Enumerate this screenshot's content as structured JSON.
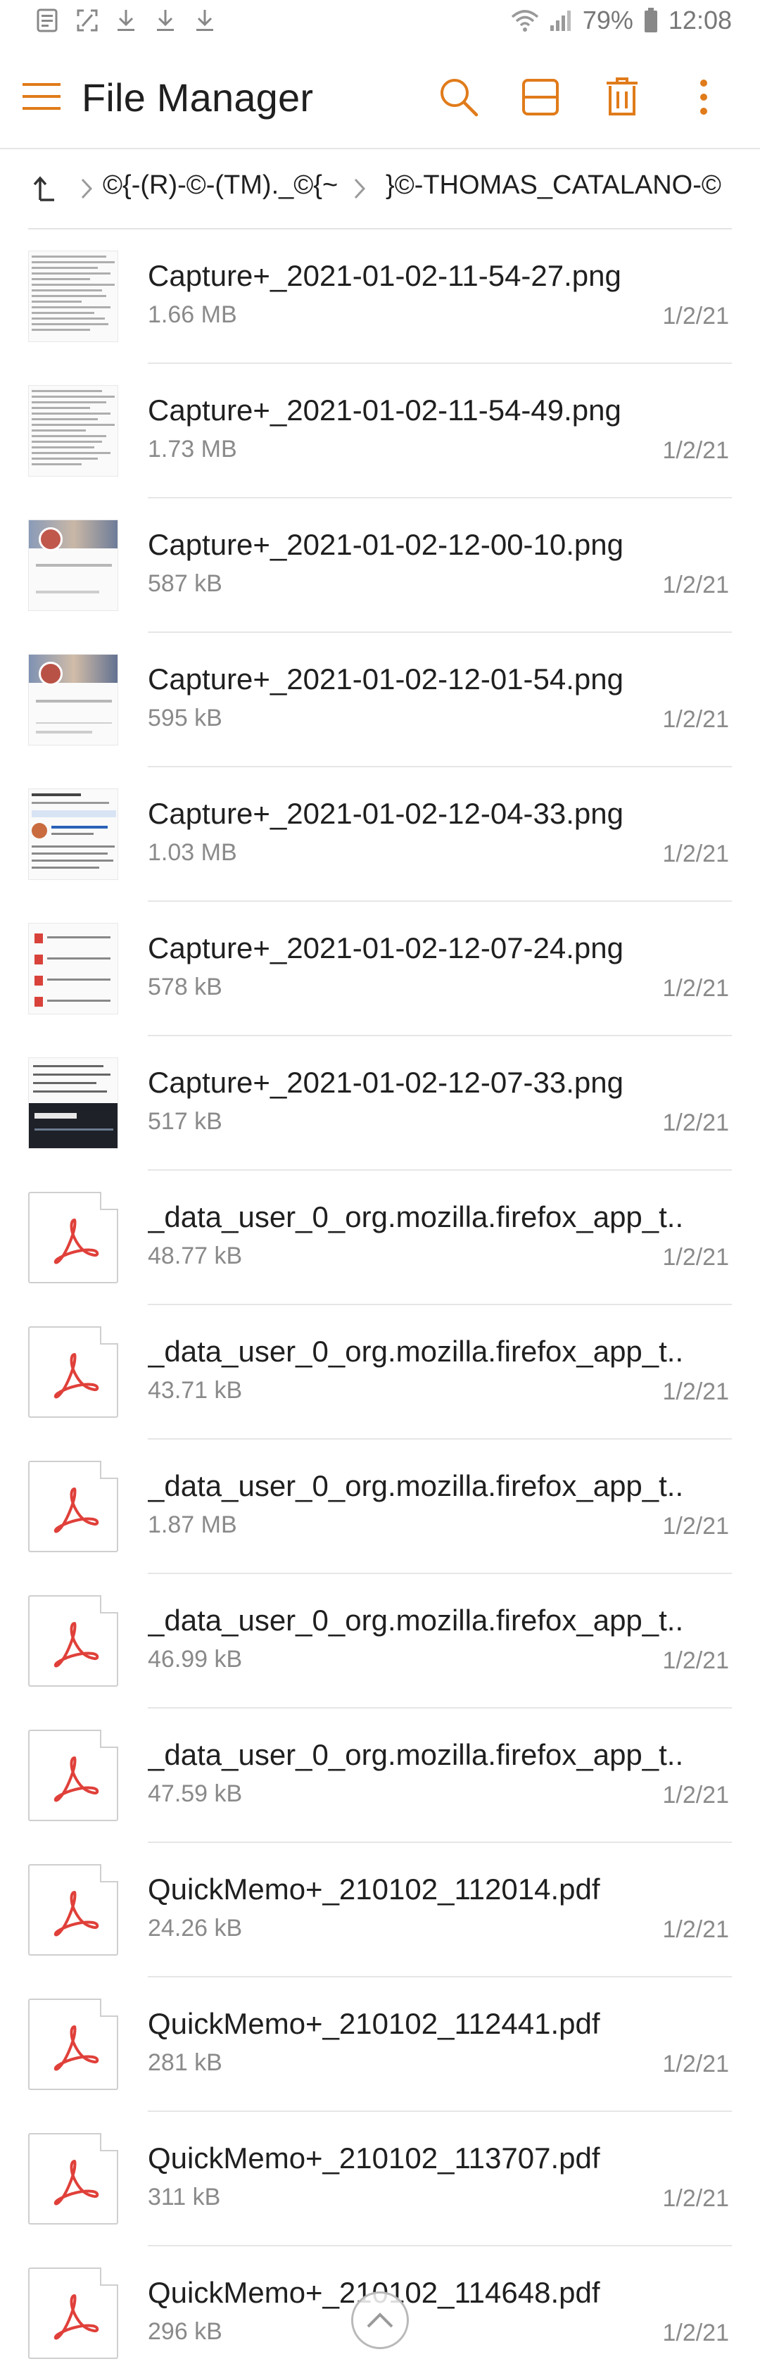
{
  "status_bar": {
    "battery_percent": "79%",
    "time": "12:08",
    "left_icons": [
      "notification-icon",
      "screenshot-icon",
      "download-icon",
      "download-icon",
      "download-icon"
    ],
    "right_icons": [
      "wifi-icon",
      "signal-icon",
      "battery-icon"
    ]
  },
  "app_bar": {
    "title": "File Manager",
    "actions": [
      "search-icon",
      "view-toggle-icon",
      "delete-icon",
      "more-vert-icon"
    ]
  },
  "breadcrumb": {
    "segments": [
      "©{-(R)-©-(TM)._©{~",
      "}©-THOMAS_CATALANO-©"
    ]
  },
  "colors": {
    "accent": "#e07b1a",
    "pdf_red": "#e0403a",
    "secondary_text": "#8a8a8a",
    "divider": "#e6e6e6"
  },
  "files": [
    {
      "name": "Capture+_2021-01-02-11-54-27.png",
      "size": "1.66 MB",
      "date": "1/2/21",
      "type": "image-text"
    },
    {
      "name": "Capture+_2021-01-02-11-54-49.png",
      "size": "1.73 MB",
      "date": "1/2/21",
      "type": "image-text"
    },
    {
      "name": "Capture+_2021-01-02-12-00-10.png",
      "size": "587 kB",
      "date": "1/2/21",
      "type": "image-photo"
    },
    {
      "name": "Capture+_2021-01-02-12-01-54.png",
      "size": "595 kB",
      "date": "1/2/21",
      "type": "image-photo"
    },
    {
      "name": "Capture+_2021-01-02-12-04-33.png",
      "size": "1.03 MB",
      "date": "1/2/21",
      "type": "image-web"
    },
    {
      "name": "Capture+_2021-01-02-12-07-24.png",
      "size": "578 kB",
      "date": "1/2/21",
      "type": "image-list"
    },
    {
      "name": "Capture+_2021-01-02-12-07-33.png",
      "size": "517 kB",
      "date": "1/2/21",
      "type": "image-dark"
    },
    {
      "name": "_data_user_0_org.mozilla.firefox_app_t..",
      "size": "48.77 kB",
      "date": "1/2/21",
      "type": "pdf"
    },
    {
      "name": "_data_user_0_org.mozilla.firefox_app_t..",
      "size": "43.71 kB",
      "date": "1/2/21",
      "type": "pdf"
    },
    {
      "name": "_data_user_0_org.mozilla.firefox_app_t..",
      "size": "1.87 MB",
      "date": "1/2/21",
      "type": "pdf"
    },
    {
      "name": "_data_user_0_org.mozilla.firefox_app_t..",
      "size": "46.99 kB",
      "date": "1/2/21",
      "type": "pdf"
    },
    {
      "name": "_data_user_0_org.mozilla.firefox_app_t..",
      "size": "47.59 kB",
      "date": "1/2/21",
      "type": "pdf"
    },
    {
      "name": "QuickMemo+_210102_112014.pdf",
      "size": "24.26 kB",
      "date": "1/2/21",
      "type": "pdf"
    },
    {
      "name": "QuickMemo+_210102_112441.pdf",
      "size": "281 kB",
      "date": "1/2/21",
      "type": "pdf"
    },
    {
      "name": "QuickMemo+_210102_113707.pdf",
      "size": "311 kB",
      "date": "1/2/21",
      "type": "pdf"
    },
    {
      "name": "QuickMemo+_210102_114648.pdf",
      "size": "296 kB",
      "date": "1/2/21",
      "type": "pdf"
    }
  ],
  "scroll_top": {
    "icon": "chevron-up-icon"
  }
}
